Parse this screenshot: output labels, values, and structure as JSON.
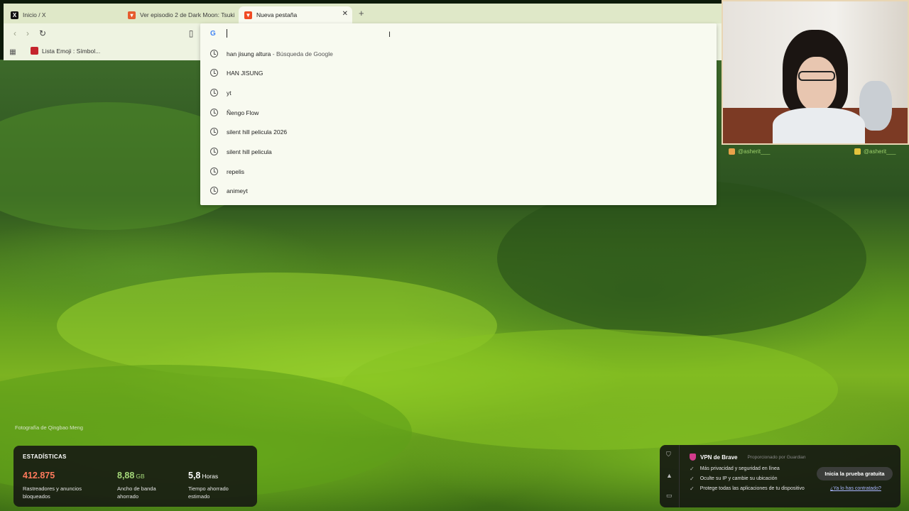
{
  "tabs": [
    {
      "label": "Inicio / X",
      "icon": "x-logo-icon"
    },
    {
      "label": "Ver episodio 2 de Dark Moon: Tsuki",
      "icon": "anime-site-icon"
    },
    {
      "label": "Nueva pestaña",
      "icon": "brave-icon"
    }
  ],
  "bookmarks": [
    {
      "label": "Lista Emoji : Símbol..."
    }
  ],
  "omnibox": {
    "value": "",
    "suggestions": [
      {
        "text": "han jisung altura",
        "suffix": " - Búsqueda de Google"
      },
      {
        "text": "HAN JISUNG",
        "suffix": ""
      },
      {
        "text": "yt",
        "suffix": ""
      },
      {
        "text": "Ñengo Flow",
        "suffix": ""
      },
      {
        "text": "silent hill pelicula 2026",
        "suffix": ""
      },
      {
        "text": "silent hill pelicula",
        "suffix": ""
      },
      {
        "text": "repelis",
        "suffix": ""
      },
      {
        "text": "animeyt",
        "suffix": ""
      }
    ]
  },
  "social": {
    "left": "@asherit___",
    "right": "@asherit___"
  },
  "wallpaper": {
    "credit": "Fotografía de Qingbao Meng"
  },
  "stats": {
    "title": "ESTADÍSTICAS",
    "trackers": {
      "value": "412.875",
      "label": "Rastreadores y anuncios bloqueados",
      "color": "#ff7a5c"
    },
    "bandwidth": {
      "value": "8,88",
      "unit": "GB",
      "label": "Ancho de banda ahorrado",
      "color": "#a6d97a"
    },
    "time": {
      "value": "5,8",
      "unit": "Horas",
      "label": "Tiempo ahorrado estimado",
      "color": "#ffffff"
    }
  },
  "vpn": {
    "title": "VPN de Brave",
    "provider": "Proporcionado por Guardian",
    "features": [
      "Más privacidad y seguridad en línea",
      "Oculte su IP y cambie su ubicación",
      "Protege todas las aplicaciones de tu dispositivo"
    ],
    "cta": "Inicia la prueba gratuita",
    "link": "¿Ya lo has contratado?"
  }
}
